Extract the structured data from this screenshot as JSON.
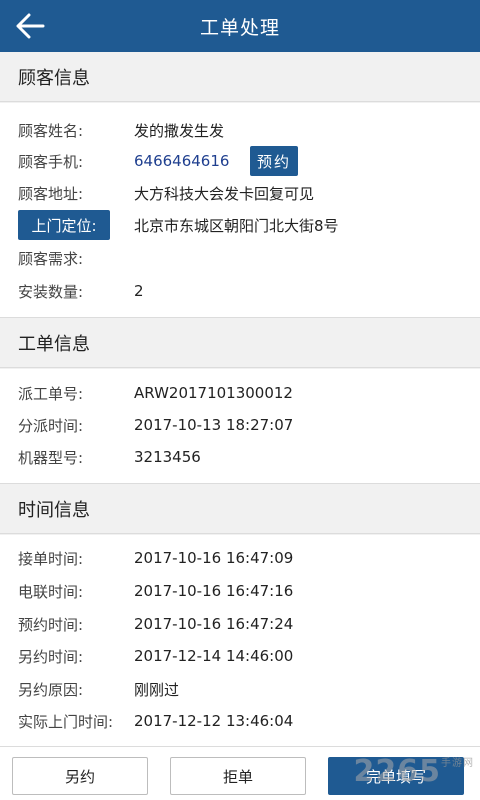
{
  "header": {
    "title": "工单处理",
    "back_icon": "arrow-left-icon"
  },
  "customer": {
    "section_title": "顾客信息",
    "name_label": "顾客姓名:",
    "name_value": "发的撒发生发",
    "phone_label": "顾客手机:",
    "phone_value": "6466464616",
    "book_button": "预约",
    "address_label": "顾客地址:",
    "address_value": "大方科技大会发卡回复可见",
    "locate_button": "上门定位:",
    "locate_value": "北京市东城区朝阳门北大街8号",
    "demand_label": "顾客需求:",
    "demand_value": "",
    "quantity_label": "安装数量:",
    "quantity_value": "2"
  },
  "order": {
    "section_title": "工单信息",
    "dispatch_no_label": "派工单号:",
    "dispatch_no_value": "ARW2017101300012",
    "assign_time_label": "分派时间:",
    "assign_time_value": "2017-10-13 18:27:07",
    "model_label": "机器型号:",
    "model_value": "3213456"
  },
  "time": {
    "section_title": "时间信息",
    "receive_label": "接单时间:",
    "receive_value": "2017-10-16 16:47:09",
    "call_label": "电联时间:",
    "call_value": "2017-10-16 16:47:16",
    "appointment_label": "预约时间:",
    "appointment_value": "2017-10-16 16:47:24",
    "reschedule_label": "另约时间:",
    "reschedule_value": "2017-12-14 14:46:00",
    "reason_label": "另约原因:",
    "reason_value": "刚刚过",
    "visit_label": "实际上门时间:",
    "visit_value": "2017-12-12 13:46:04"
  },
  "actions": {
    "reschedule": "另约",
    "reject": "拒单",
    "complete": "完单填写"
  },
  "watermark": {
    "text": "2265",
    "sub": "手游网"
  },
  "colors": {
    "primary": "#1f5a92",
    "background": "#f1f1f1"
  }
}
